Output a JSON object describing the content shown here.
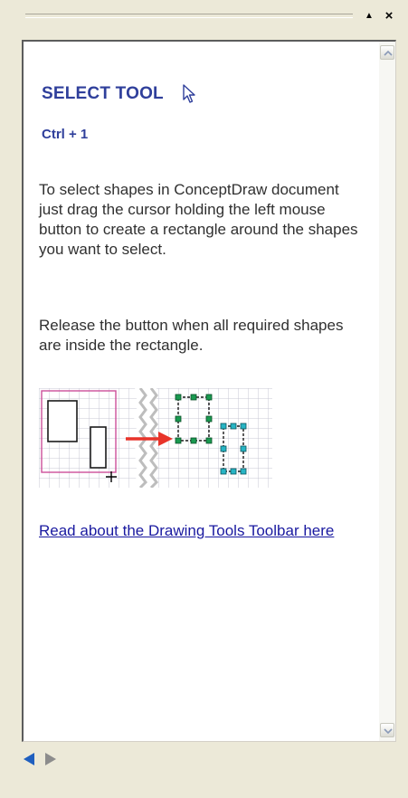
{
  "titlebar": {
    "collapse_icon": "triangle-up-icon",
    "close_icon": "close-icon",
    "close_glyph": "×",
    "collapse_glyph": "▲"
  },
  "help": {
    "title": "SELECT TOOL",
    "title_icon": "arrow-cursor-icon",
    "shortcut": "Ctrl + 1",
    "paragraph_1": "To select shapes in ConceptDraw document just drag the cursor holding the left mouse button to create a rectangle around the shapes you want to select.",
    "paragraph_2": "Release the button when all required shapes are inside the rectangle.",
    "illustration": "selection-rectangle-illustration",
    "link_text": "Read about the Drawing Tools Toolbar here"
  },
  "scrollbar": {
    "up_icon": "scroll-up-arrow-icon",
    "down_icon": "scroll-down-arrow-icon"
  },
  "navigation": {
    "back_icon": "back-arrow-icon",
    "forward_icon": "forward-arrow-icon"
  },
  "colors": {
    "heading": "#2f3f9b",
    "body_text": "#303030",
    "link": "#1a1aa0",
    "panel_bg": "#ece9d8",
    "selection_rect": "#cc4f9a",
    "arrow": "#e8342a",
    "handle_green": "#1a9a50",
    "handle_cyan": "#27b4c4"
  }
}
